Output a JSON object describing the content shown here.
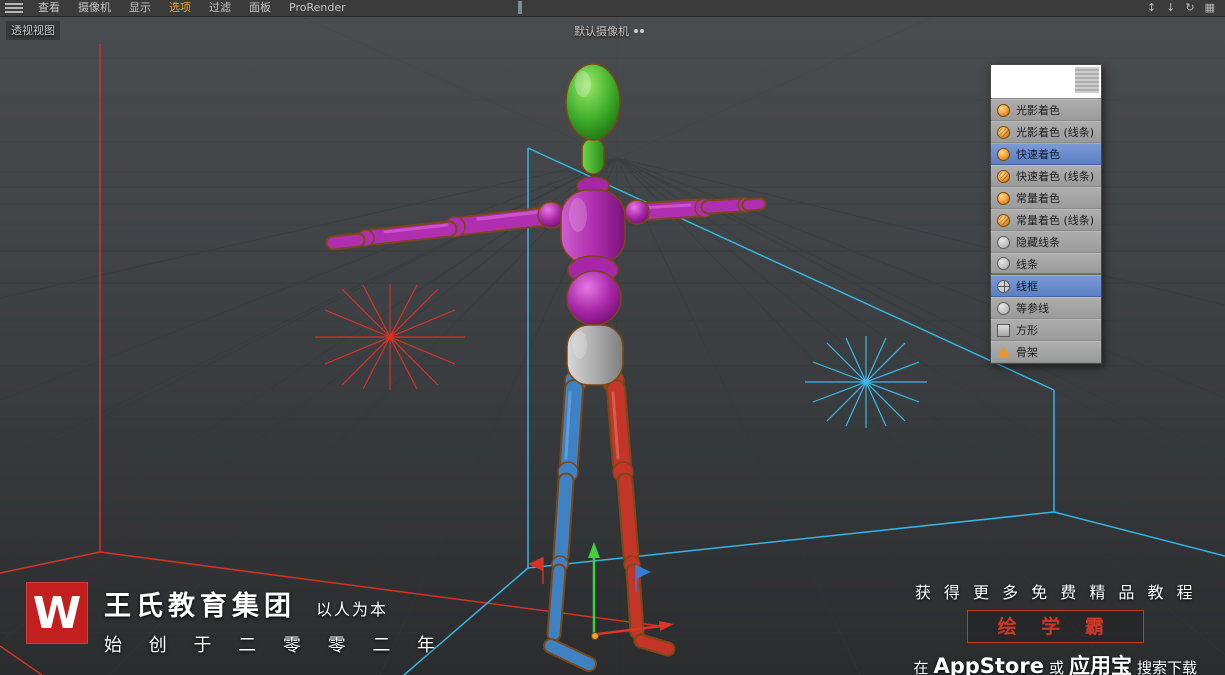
{
  "menubar": {
    "items": [
      "查看",
      "摄像机",
      "显示",
      "选项",
      "过滤",
      "面板",
      "ProRender"
    ],
    "highlighted_item": "选项",
    "right_icons": [
      {
        "name": "move-icon",
        "glyph": "↕"
      },
      {
        "name": "download-icon",
        "glyph": "↓"
      },
      {
        "name": "refresh-icon",
        "glyph": "↻"
      },
      {
        "name": "layout-icon",
        "glyph": "▦"
      }
    ]
  },
  "viewport": {
    "view_label": "透视视图",
    "camera_label": "默认摄像机"
  },
  "dropdown": {
    "items": [
      {
        "label": "光影着色",
        "icon": "sphere-orange",
        "highlighted": false,
        "separator_after": false
      },
      {
        "label": "光影着色 (线条)",
        "icon": "sphere-orange-lines",
        "highlighted": false,
        "separator_after": false
      },
      {
        "label": "快速着色",
        "icon": "sphere-orange",
        "highlighted": true,
        "separator_after": false
      },
      {
        "label": "快速着色 (线条)",
        "icon": "sphere-orange-lines",
        "highlighted": false,
        "separator_after": false
      },
      {
        "label": "常量着色",
        "icon": "sphere-orange",
        "highlighted": false,
        "separator_after": false
      },
      {
        "label": "常量着色 (线条)",
        "icon": "sphere-orange-lines",
        "highlighted": false,
        "separator_after": false
      },
      {
        "label": "隐藏线条",
        "icon": "circle-gray",
        "highlighted": false,
        "separator_after": false
      },
      {
        "label": "线条",
        "icon": "circle-gray",
        "highlighted": false,
        "separator_after": true
      },
      {
        "label": "线框",
        "icon": "globe-gray",
        "highlighted": true,
        "separator_after": false
      },
      {
        "label": "等参线",
        "icon": "circle-gray",
        "highlighted": false,
        "separator_after": false
      },
      {
        "label": "方形",
        "icon": "square-gray",
        "highlighted": false,
        "separator_after": false
      },
      {
        "label": "骨架",
        "icon": "pyramid-orange",
        "highlighted": false,
        "separator_after": false
      }
    ]
  },
  "branding": {
    "logo_letter": "W",
    "company": "王氏教育集团",
    "slogan": "以人为本",
    "since": "始 创 于 二 零 零 二 年"
  },
  "promo": {
    "line1": "获 得 更 多 免 费 精 品 教 程",
    "badge": "绘 学 霸",
    "line3_prefix": "在",
    "line3_appstore": "AppStore",
    "line3_or": "或",
    "line3_store": "应用宝",
    "line3_suffix": "搜索下载"
  },
  "colors": {
    "menu_highlight_orange": "#e8a33d",
    "dropdown_highlight_blue": "#6187c6",
    "brand_red": "#c21f1e",
    "promo_red": "#d2362b",
    "axis_red": "#d63325",
    "axis_cyan": "#35b5e2",
    "mannequin_head_green": "#41b02c",
    "mannequin_torso_magenta": "#b02fb0",
    "mannequin_pelvis_gray": "#a8a8a8",
    "mannequin_left_leg_blue": "#3f82c4",
    "mannequin_right_leg_red": "#c23528"
  }
}
